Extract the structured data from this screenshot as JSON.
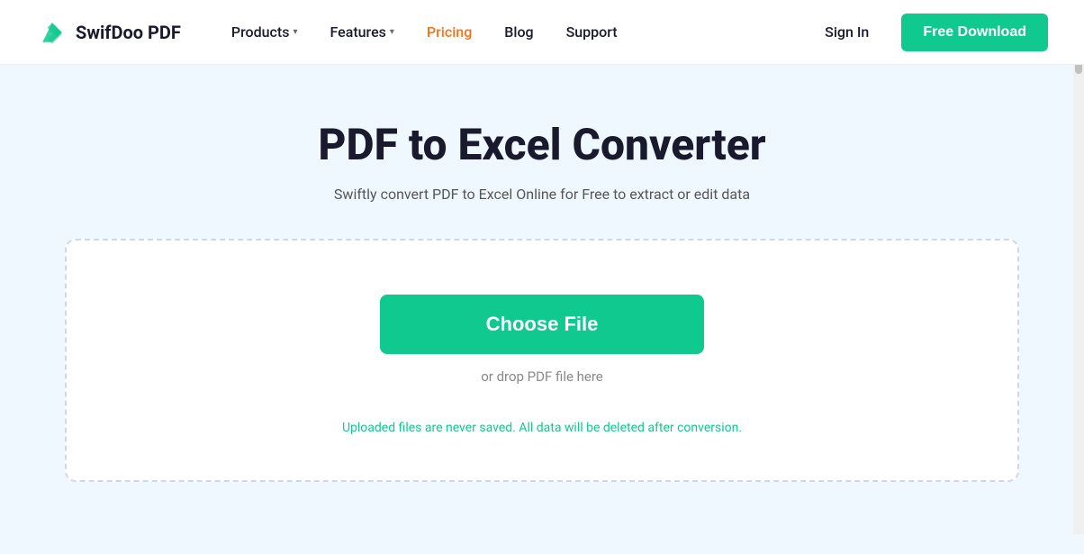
{
  "logo": {
    "text": "SwifDoo PDF"
  },
  "nav": {
    "items": [
      {
        "id": "products",
        "label": "Products",
        "hasDropdown": true,
        "active": false
      },
      {
        "id": "features",
        "label": "Features",
        "hasDropdown": true,
        "active": false
      },
      {
        "id": "pricing",
        "label": "Pricing",
        "hasDropdown": false,
        "active": true
      },
      {
        "id": "blog",
        "label": "Blog",
        "hasDropdown": false,
        "active": false
      },
      {
        "id": "support",
        "label": "Support",
        "hasDropdown": false,
        "active": false
      }
    ]
  },
  "header": {
    "sign_in_label": "Sign In",
    "free_download_label": "Free Download"
  },
  "hero": {
    "title": "PDF to Excel Converter",
    "subtitle": "Swiftly convert PDF to Excel Online for Free to extract or edit data"
  },
  "upload": {
    "choose_file_label": "Choose File",
    "drop_text": "or drop PDF file here",
    "privacy_note": "Uploaded files are never saved. All data will be deleted after conversion."
  },
  "colors": {
    "accent_green": "#10c98f",
    "active_nav": "#f97316",
    "dark_text": "#1a1a2e"
  }
}
